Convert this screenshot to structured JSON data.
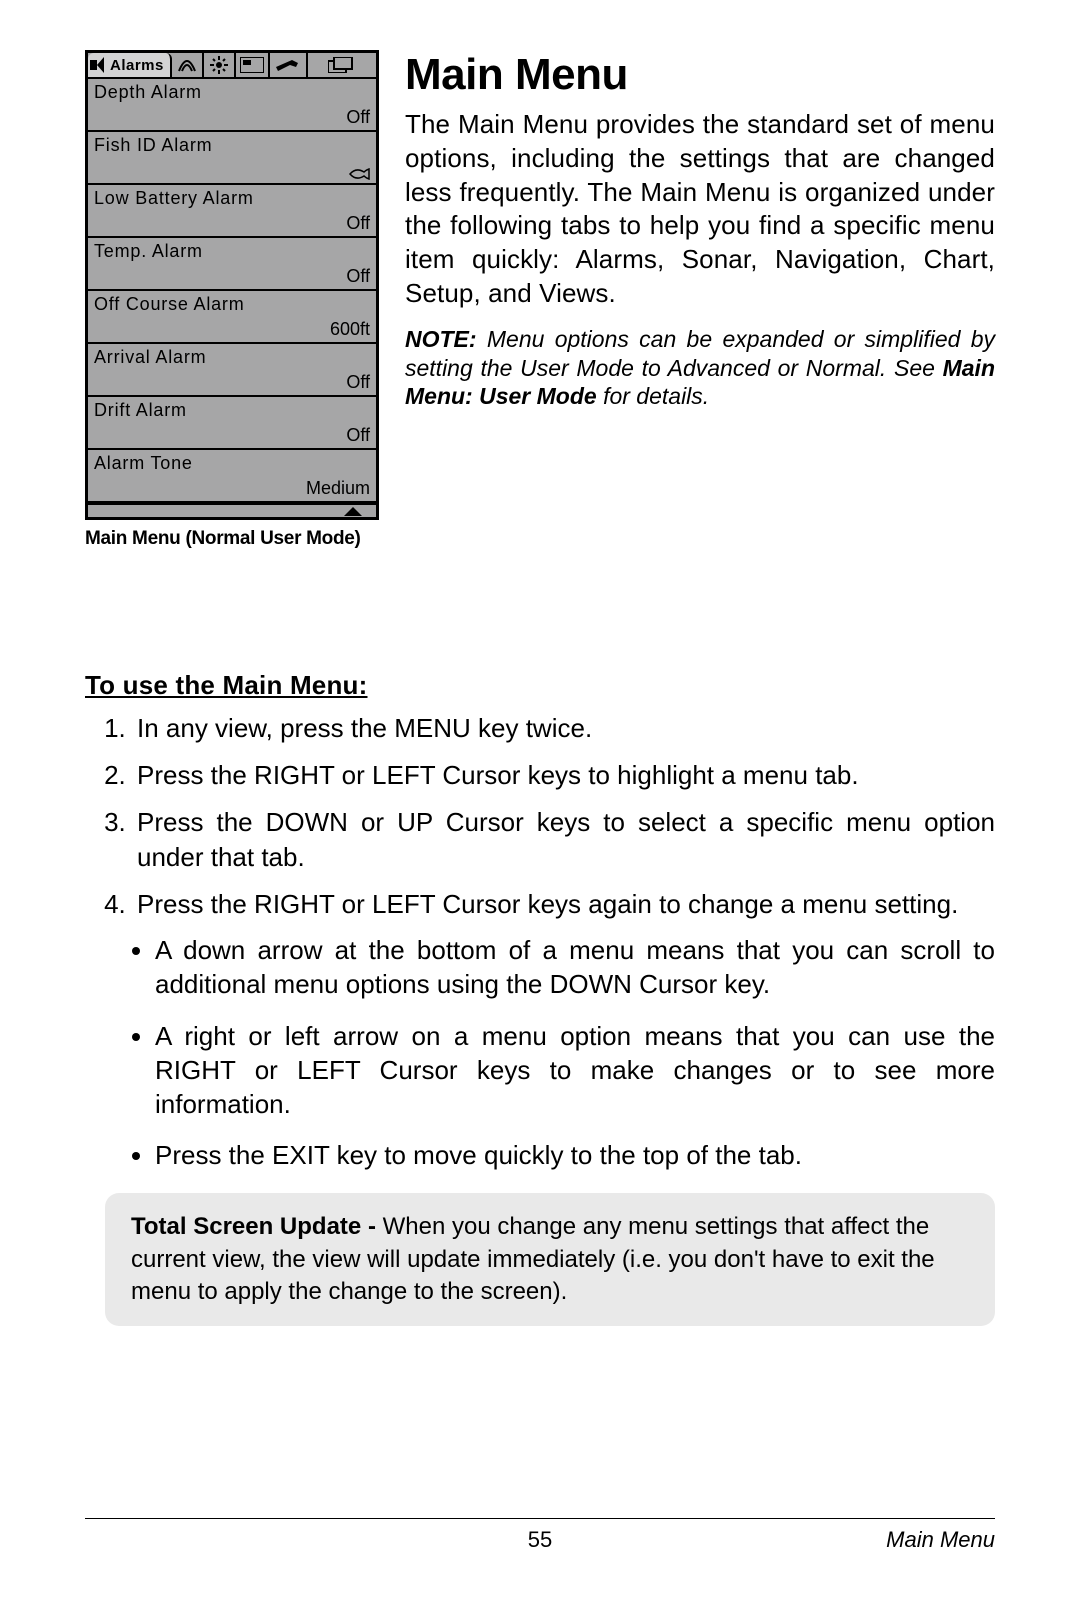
{
  "device": {
    "active_tab_label": "Alarms",
    "items": [
      {
        "label": "Depth Alarm",
        "value": "Off"
      },
      {
        "label": "Fish ID Alarm",
        "value": "fish-icon"
      },
      {
        "label": "Low Battery Alarm",
        "value": "Off"
      },
      {
        "label": "Temp. Alarm",
        "value": "Off"
      },
      {
        "label": "Off Course Alarm",
        "value": "600ft"
      },
      {
        "label": "Arrival Alarm",
        "value": "Off"
      },
      {
        "label": "Drift Alarm",
        "value": "Off"
      },
      {
        "label": "Alarm Tone",
        "value": "Medium"
      }
    ],
    "caption": "Main Menu (Normal User Mode)"
  },
  "heading": "Main Menu",
  "intro": "The Main Menu provides the standard set of menu options, including the settings that are changed less frequently. The Main Menu is organized under the following tabs to help you find a specific menu item quickly: Alarms, Sonar, Navigation, Chart, Setup, and Views.",
  "note_label": "NOTE:",
  "note_body": " Menu options can be expanded or simplified by setting the User Mode to Advanced or Normal. See ",
  "note_ref": "Main Menu: User Mode",
  "note_tail": " for details.",
  "subheading": "To use the Main Menu:",
  "steps": [
    "In any view, press the MENU key twice.",
    "Press the RIGHT or LEFT Cursor keys to highlight a menu tab.",
    "Press the DOWN or UP Cursor keys to select a specific menu option under that tab.",
    "Press the RIGHT or LEFT Cursor keys again to change a menu setting."
  ],
  "bullets": [
    "A down arrow at the bottom of a menu means that you can scroll to additional menu options using the DOWN Cursor key.",
    "A right or left arrow on a menu option means that you can use the RIGHT or LEFT Cursor keys to make changes or to see more information.",
    "Press the EXIT key to move quickly to the top of the tab."
  ],
  "tip_title": "Total Screen Update - ",
  "tip_body": "When you change any menu settings that affect the current view, the view will update immediately (i.e. you don't have to exit the menu to apply the change to the screen).",
  "footer": {
    "page": "55",
    "section": "Main Menu"
  }
}
